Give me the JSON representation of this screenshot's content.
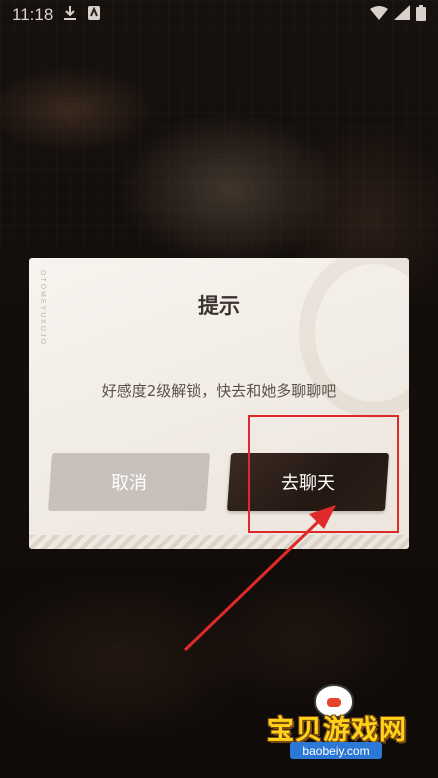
{
  "status_bar": {
    "time": "11:18",
    "icons": [
      "download-icon",
      "app-notification-icon",
      "wifi-icon",
      "signal-icon",
      "battery-icon"
    ]
  },
  "dialog": {
    "title": "提示",
    "message": "好感度2级解锁，快去和她多聊聊吧",
    "cancel_label": "取消",
    "confirm_label": "去聊天",
    "deco_text": "OTOMEYUKUJO"
  },
  "annotation": {
    "color": "#e02a2a",
    "highlight_target": "confirm-button",
    "arrow": "pointing-to-confirm-button"
  },
  "watermark": {
    "text": "宝贝游戏网",
    "url": "baobeiy.com",
    "text_color": "#ffd21a",
    "url_bg_color": "#2c78d6"
  },
  "colors": {
    "dialog_bg": "#f7f3ee",
    "cancel_bg": "#c8c0bb",
    "confirm_bg": "#2a1d17",
    "title_color": "#3a3330"
  }
}
